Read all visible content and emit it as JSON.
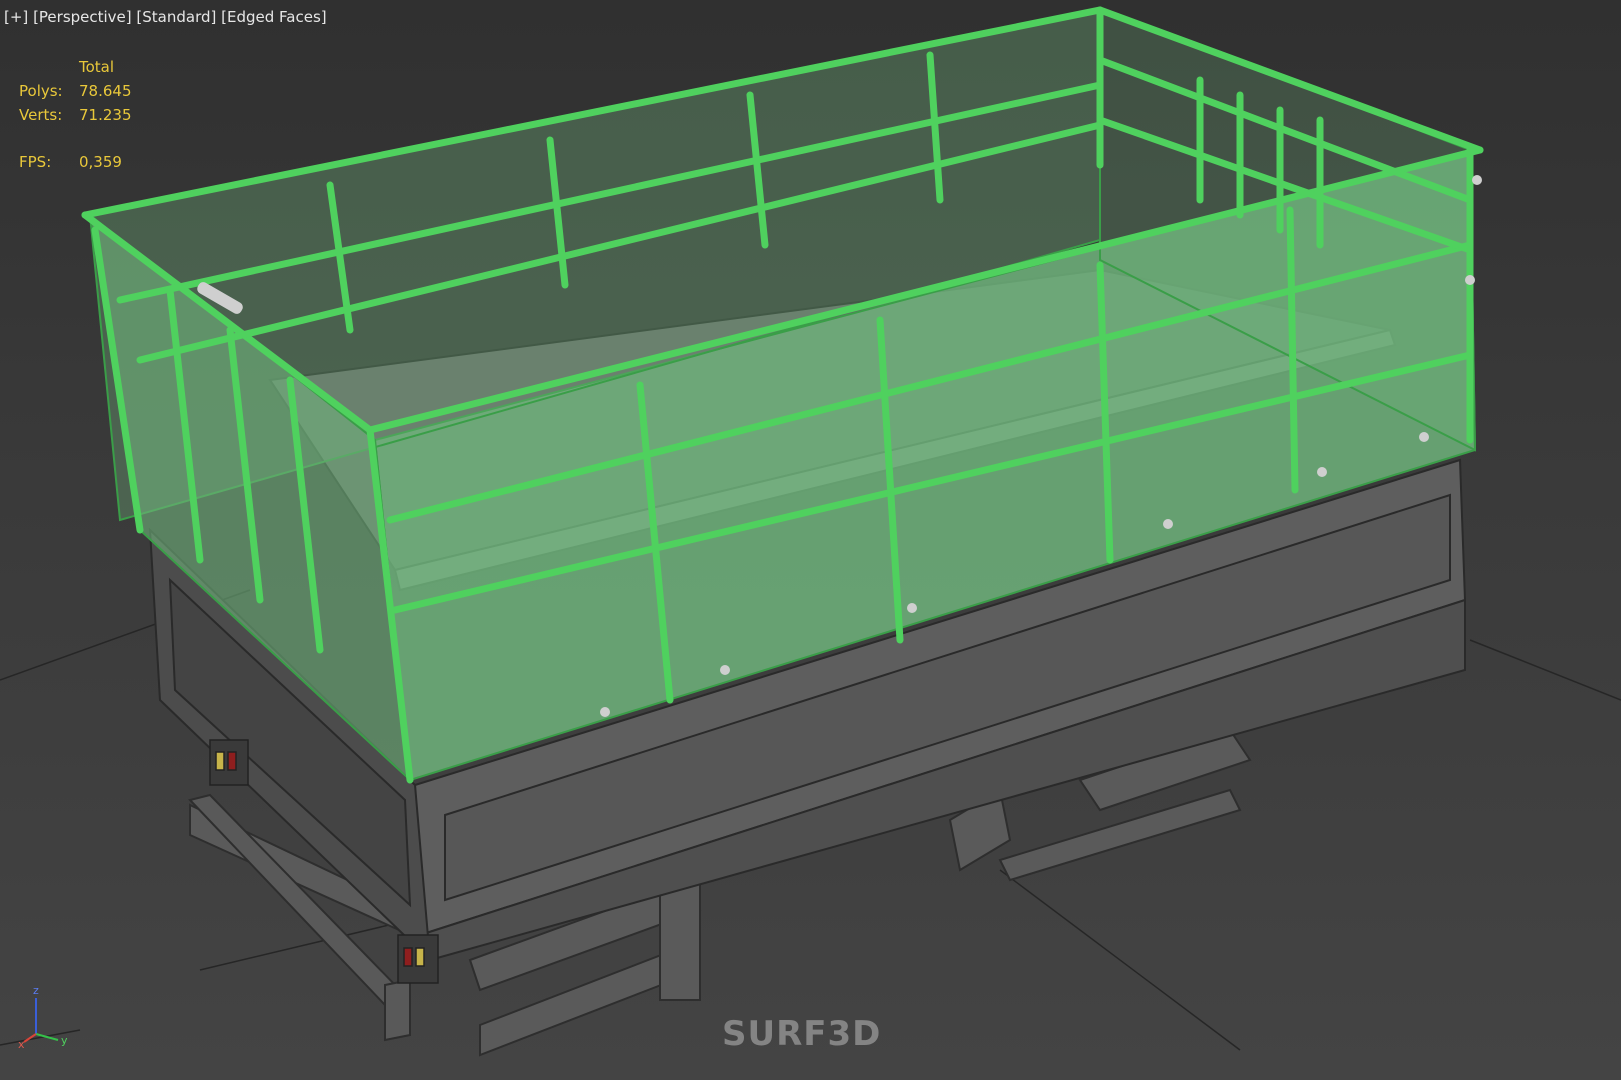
{
  "viewport": {
    "label_parts": [
      "[+]",
      "[Perspective]",
      "[Standard]",
      "[Edged Faces]"
    ]
  },
  "stats": {
    "total_label": "Total",
    "polys_label": "Polys:",
    "polys_value": "78.645",
    "verts_label": "Verts:",
    "verts_value": "71.235",
    "fps_label": "FPS:",
    "fps_value": "0,359"
  },
  "axis": {
    "x": "x",
    "y": "y",
    "z": "z"
  },
  "watermark": "SURF3D",
  "colors": {
    "cage_fill": "#6fb37b",
    "cage_line": "#4fd15e",
    "body": "#5c5c5c",
    "body_dark": "#474747",
    "stats_text": "#e9c83a"
  }
}
